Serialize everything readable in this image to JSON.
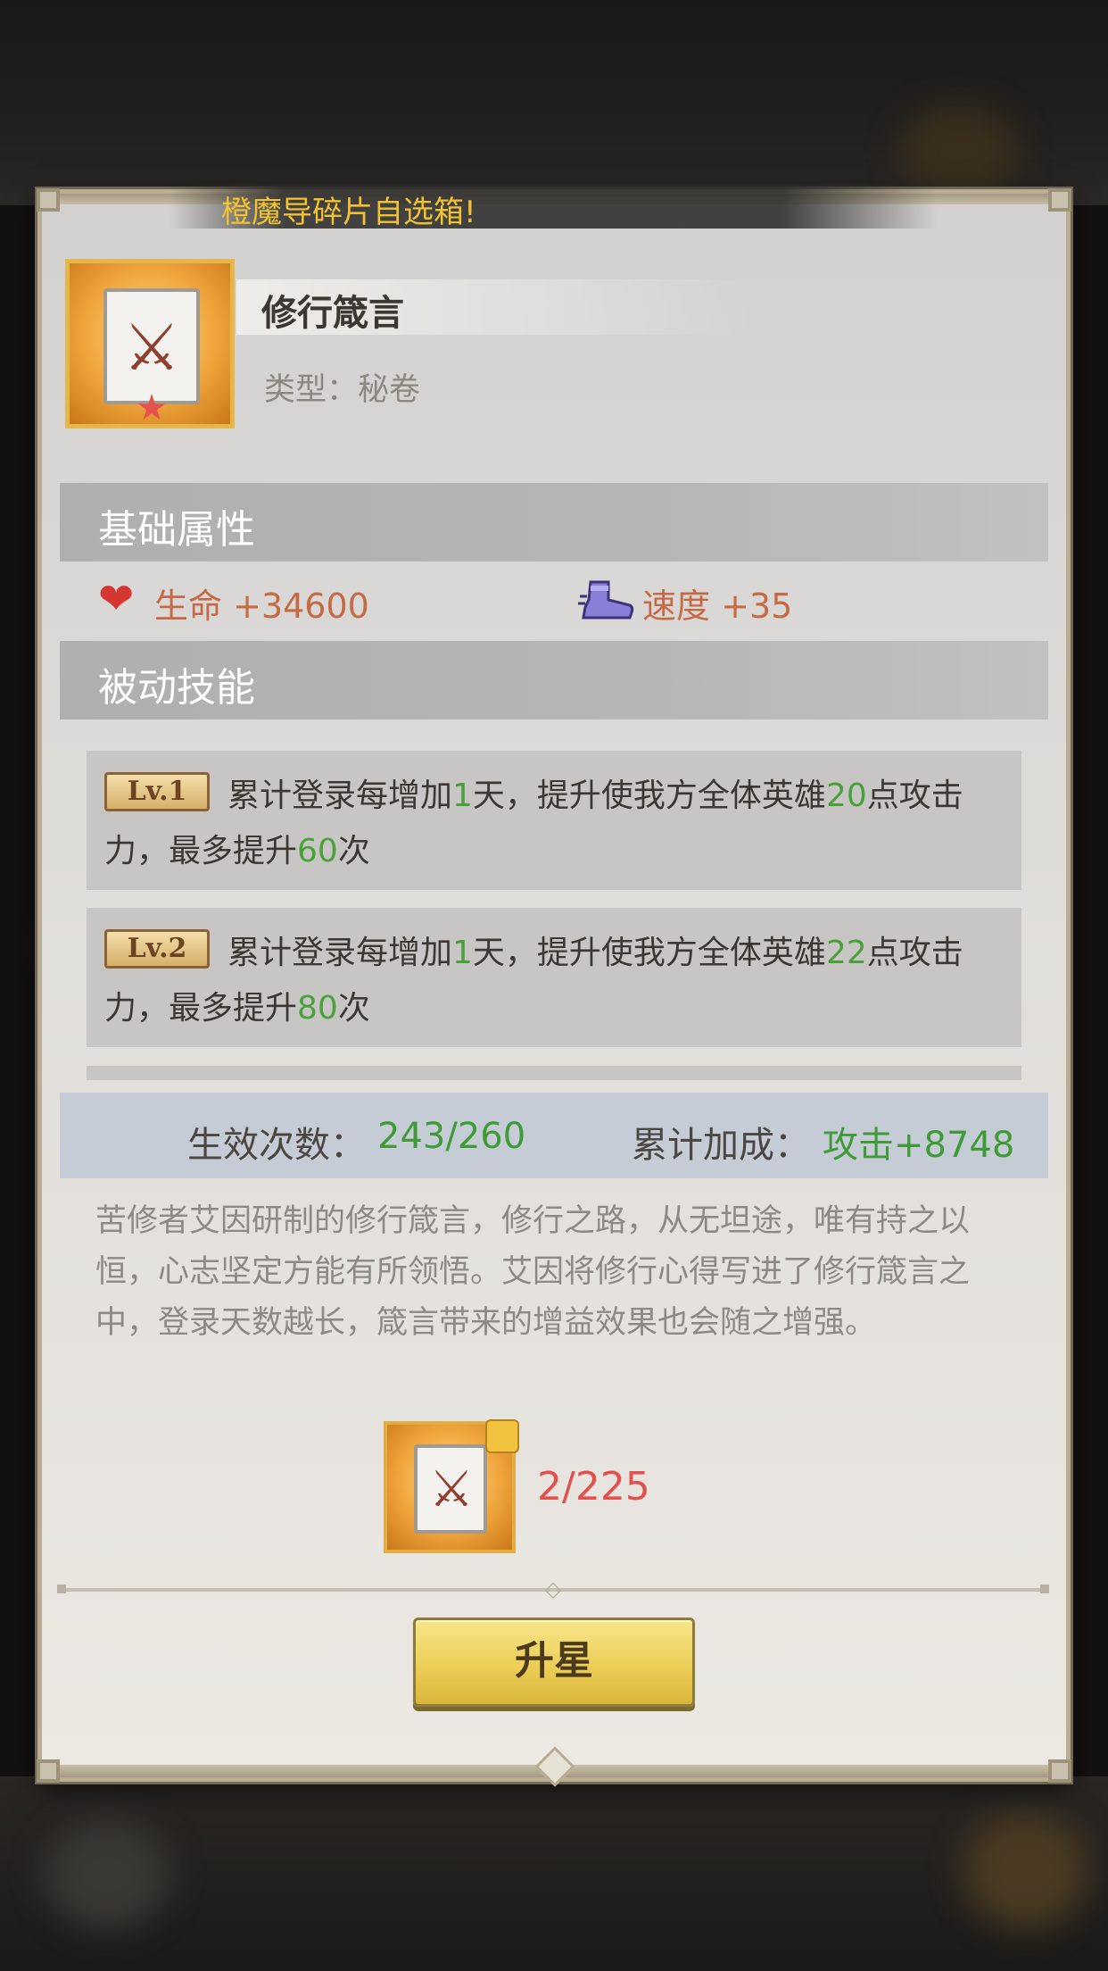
{
  "banner": {
    "text": "橙魔导碎片自选箱!"
  },
  "item": {
    "name": "修行箴言",
    "type_label": "类型：",
    "type_value": "秘卷",
    "icon": "sword-tome-icon",
    "star_icon": "star-icon"
  },
  "sections": {
    "basic": "基础属性",
    "passive": "被动技能"
  },
  "stats": [
    {
      "icon": "heart-icon",
      "label": "生命",
      "value": "+34600"
    },
    {
      "icon": "boot-icon",
      "label": "速度",
      "value": "+35"
    }
  ],
  "skills": [
    {
      "level": "Lv.1",
      "parts": [
        "累计登录每增加",
        "1",
        "天，提升使我方全体英雄",
        "20",
        "点攻击力，最多提升",
        "60",
        "次"
      ]
    },
    {
      "level": "Lv.2",
      "parts": [
        "累计登录每增加",
        "1",
        "天，提升使我方全体英雄",
        "22",
        "点攻击力，最多提升",
        "80",
        "次"
      ]
    }
  ],
  "effect": {
    "count_label": "生效次数：",
    "count_value": "243/260",
    "bonus_label": "累计加成：",
    "bonus_value": "攻击+8748"
  },
  "description": "苦修者艾因研制的修行箴言，修行之路，从无坦途，唯有持之以恒，心志坚定方能有所领悟。艾因将修行心得写进了修行箴言之中，登录天数越长，箴言带来的增益效果也会随之增强。",
  "fragment": {
    "count": "2/225",
    "icon": "puzzle-piece-icon"
  },
  "button": {
    "label": "升星"
  },
  "colors": {
    "accent_green": "#4aa13b",
    "stat_orange": "#c66a46",
    "fragment_red": "#e0524d",
    "button_gold": "#eccf58"
  }
}
